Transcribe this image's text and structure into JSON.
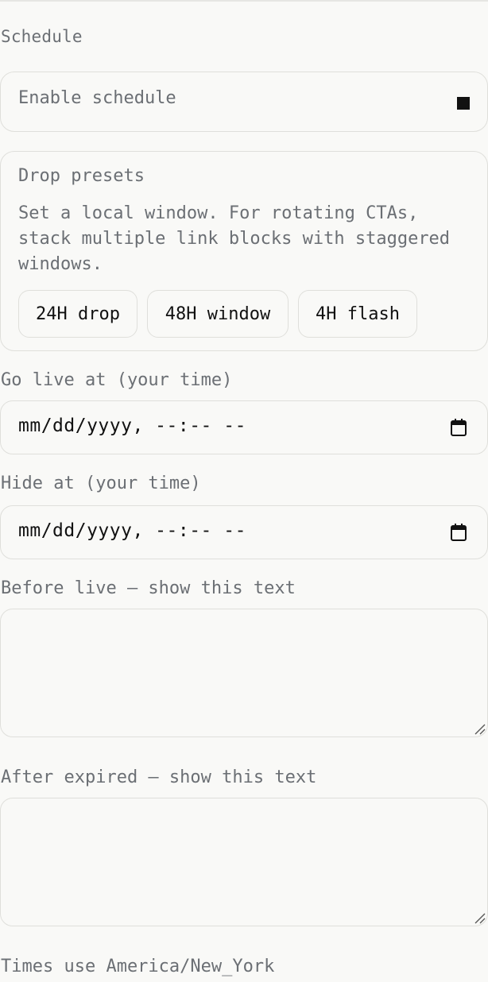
{
  "schedule": {
    "section_title": "Schedule",
    "enable": {
      "label": "Enable schedule",
      "checked": true
    },
    "presets": {
      "title": "Drop presets",
      "help": "Set a local window. For rotating CTAs, stack multiple link blocks with staggered windows.",
      "buttons": [
        "24H drop",
        "48H window",
        "4H flash"
      ]
    },
    "go_live": {
      "label": "Go live at (your time)",
      "value": "mm/dd/yyyy, --:-- --",
      "icon": "calendar-icon"
    },
    "hide_at": {
      "label": "Hide at (your time)",
      "value": "mm/dd/yyyy, --:-- --",
      "icon": "calendar-icon"
    },
    "before_text": {
      "label": "Before live — show this text",
      "value": ""
    },
    "after_text": {
      "label": "After expired — show this text",
      "value": ""
    },
    "timezone_note": "Times use America/New_York"
  },
  "colors": {
    "background": "#f9f9f7",
    "border": "#dfdfdb",
    "label_text": "#6b6f74",
    "strong_text": "#111111"
  }
}
